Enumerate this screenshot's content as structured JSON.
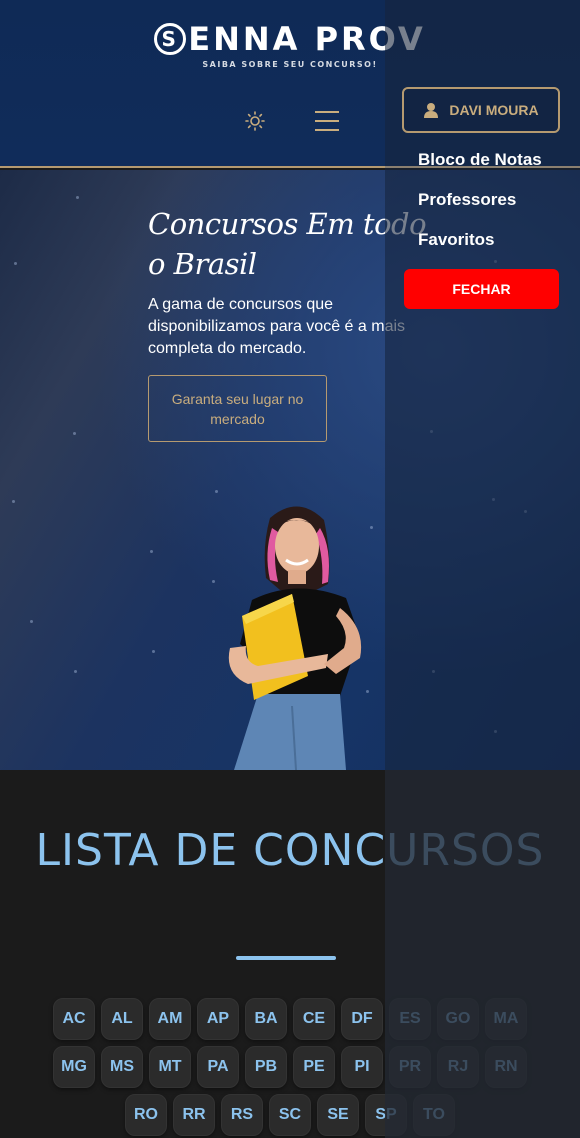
{
  "header": {
    "logo_text": "ENNA PROV",
    "logo_letter": "S",
    "tagline": "SAIBA SOBRE SEU CONCURSO!"
  },
  "hero": {
    "title": "Concursos Em todo o Brasil",
    "subtitle": "A gama de concursos que disponibilizamos para você é a mais completa do mercado.",
    "cta_label": "Garanta seu lugar no mercado"
  },
  "list": {
    "title": "LISTA DE CONCURSOS",
    "states_row1": [
      "AC",
      "AL",
      "AM",
      "AP",
      "BA",
      "CE",
      "DF",
      "ES",
      "GO",
      "MA"
    ],
    "states_row2": [
      "MG",
      "MS",
      "MT",
      "PA",
      "PB",
      "PE",
      "PI",
      "PR",
      "RJ",
      "RN"
    ],
    "states_row3": [
      "RO",
      "RR",
      "RS",
      "SC",
      "SE",
      "SP",
      "TO"
    ]
  },
  "drawer": {
    "user_name": "DAVI MOURA",
    "links": [
      "Bloco de Notas",
      "Professores",
      "Favoritos"
    ],
    "close_label": "FECHAR"
  },
  "colors": {
    "accent_gold": "#c9ad7e",
    "accent_blue": "#8cc3ee",
    "close_red": "#ff0000",
    "header_bg": "#0f2a56"
  },
  "icons": [
    "sun-icon",
    "hamburger-menu-icon",
    "user-icon"
  ]
}
